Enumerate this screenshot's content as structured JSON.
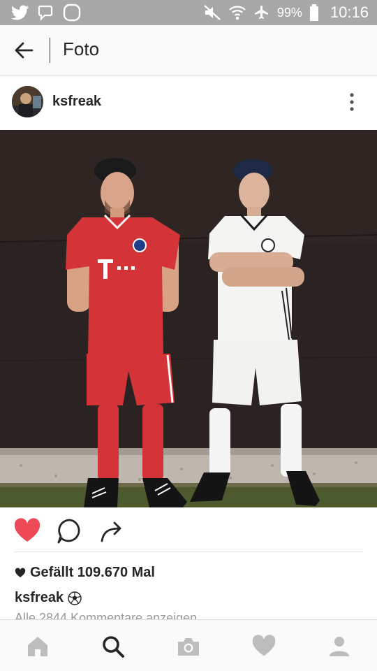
{
  "status_bar": {
    "battery": "99%",
    "time": "10:16",
    "icons": [
      "twitter-icon",
      "message-icon",
      "app-icon",
      "mute-icon",
      "wifi-icon",
      "airplane-icon",
      "battery-icon"
    ]
  },
  "header": {
    "title": "Foto",
    "back_icon": "arrow-left-icon"
  },
  "post": {
    "username": "ksfreak",
    "more_icon": "more-vertical-icon",
    "likes_text": "Gefällt 109.670 Mal",
    "caption_user": "ksfreak",
    "caption_emoji": "soccer-ball-icon",
    "comments_link": "Alle 2844 Kommentare anzeigen",
    "liked": true
  },
  "actions": [
    "heart-icon",
    "comment-icon",
    "share-icon"
  ],
  "bottom_nav": [
    "home-icon",
    "search-icon",
    "camera-icon",
    "activity-heart-icon",
    "profile-icon"
  ],
  "colors": {
    "status_bar": "#a8a8a8",
    "like_red": "#ed4956",
    "text_dark": "#262626",
    "text_muted": "#999999"
  }
}
